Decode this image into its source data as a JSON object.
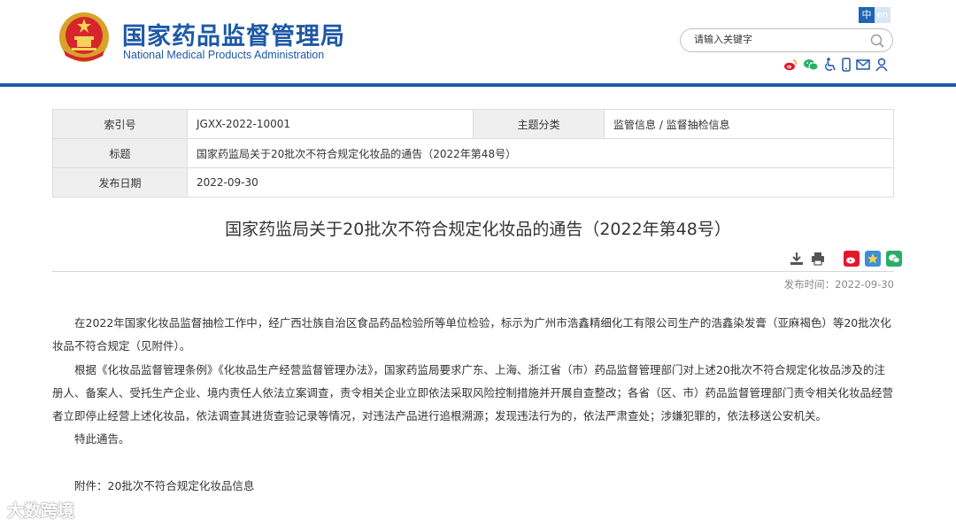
{
  "header": {
    "site_name_cn": "国家药品监督管理局",
    "site_name_en": "National Medical Products Administration",
    "lang_zh": "中",
    "lang_en": "en",
    "search_placeholder": "请输入关键字",
    "tool_icons": [
      "weibo-icon",
      "wechat-icon",
      "accessibility-icon",
      "mobile-icon",
      "mail-icon",
      "user-icon"
    ]
  },
  "info": {
    "index_label": "索引号",
    "index_value": "JGXX-2022-10001",
    "category_label": "主题分类",
    "category_value": "监管信息 / 监督抽检信息",
    "title_label": "标题",
    "title_value": "国家药监局关于20批次不符合规定化妆品的通告（2022年第48号）",
    "date_label": "发布日期",
    "date_value": "2022-09-30"
  },
  "article": {
    "title": "国家药监局关于20批次不符合规定化妆品的通告（2022年第48号）",
    "pub_time": "发布时间：2022-09-30",
    "paragraphs": [
      "在2022年国家化妆品监督抽检工作中，经广西壮族自治区食品药品检验所等单位检验，标示为广州市浩鑫精细化工有限公司生产的浩鑫染发膏（亚麻褐色）等20批次化妆品不符合规定（见附件）。",
      "根据《化妆品监督管理条例》《化妆品生产经营监督管理办法》，国家药监局要求广东、上海、浙江省（市）药品监督管理部门对上述20批次不符合规定化妆品涉及的注册人、备案人、受托生产企业、境内责任人依法立案调查，责令相关企业立即依法采取风险控制措施并开展自查整改；各省（区、市）药品监督管理部门责令相关化妆品经营者立即停止经营上述化妆品，依法调查其进货查验记录等情况，对违法产品进行追根溯源；发现违法行为的，依法严肃查处；涉嫌犯罪的，依法移送公安机关。",
      "特此通告。"
    ],
    "attachment": "附件：20批次不符合规定化妆品信息"
  },
  "watermark": "大数跨境",
  "colors": {
    "brand_blue": "#1e58a6",
    "rule_blue": "#1e5aa8",
    "table_key_bg": "#efefef",
    "weibo_red": "#e6162d",
    "wechat_green": "#2aae67"
  }
}
